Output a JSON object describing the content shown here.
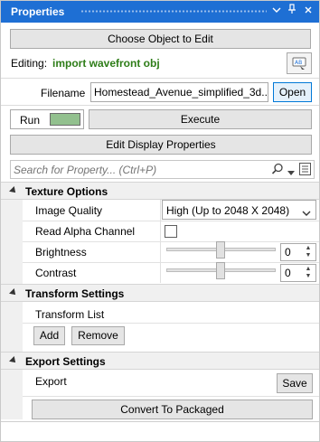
{
  "window": {
    "title": "Properties",
    "controls": [
      "chevron-down-icon",
      "pin-icon",
      "close-icon"
    ]
  },
  "toolbar": {
    "choose_object_label": "Choose Object to Edit"
  },
  "editing": {
    "label": "Editing:",
    "value": "import wavefront obj",
    "value_color": "#2e7d18",
    "rename_icon": "rename-tag-icon"
  },
  "filename": {
    "label": "Filename",
    "value": "Homestead_Avenue_simplified_3d...",
    "open_label": "Open",
    "open_button_bg": "#e5f1fb",
    "open_button_border": "#0078d7"
  },
  "run": {
    "label": "Run",
    "swatch_color": "#92c08e",
    "execute_label": "Execute"
  },
  "display": {
    "edit_display_label": "Edit Display Properties"
  },
  "search": {
    "placeholder": "Search for Property... (Ctrl+P)",
    "icons": [
      "search-icon",
      "dropdown-arrow-icon",
      "property-list-icon"
    ]
  },
  "sections": {
    "texture": {
      "title": "Texture Options",
      "image_quality_label": "Image Quality",
      "image_quality_value": "High (Up to 2048 X 2048)",
      "read_alpha_label": "Read Alpha Channel",
      "read_alpha_checked": false,
      "brightness_label": "Brightness",
      "brightness_value": "0",
      "contrast_label": "Contrast",
      "contrast_value": "0"
    },
    "transform": {
      "title": "Transform Settings",
      "list_label": "Transform List",
      "add_label": "Add",
      "remove_label": "Remove"
    },
    "export": {
      "title": "Export Settings",
      "export_label": "Export",
      "save_label": "Save",
      "convert_label": "Convert To Packaged"
    }
  },
  "colors": {
    "title_bar": "#1e6fd4",
    "section_bg": "#f0f0f0",
    "button_bg": "#e5e5e5"
  }
}
